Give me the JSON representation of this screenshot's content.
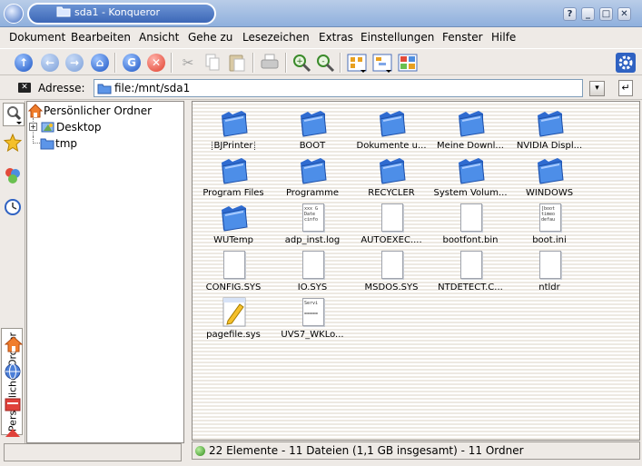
{
  "window": {
    "title": "sda1 - Konqueror",
    "buttons": [
      "?",
      "_",
      "□",
      "✕"
    ]
  },
  "menu": [
    "Dokument",
    "Bearbeiten",
    "Ansicht",
    "Gehe zu",
    "Lesezeichen",
    "Extras",
    "Einstellungen",
    "Fenster",
    "Hilfe"
  ],
  "toolbar": {
    "icons": [
      "up-arrow-icon",
      "back-arrow-icon",
      "forward-arrow-icon",
      "home-icon",
      "reload-icon",
      "stop-icon",
      "cut-icon",
      "copy-icon",
      "paste-icon",
      "print-icon",
      "zoom-in-icon",
      "zoom-out-icon",
      "icon-view-icon",
      "tree-view-icon",
      "multi-view-icon",
      "konqueror-gear-icon"
    ]
  },
  "location": {
    "label": "Adresse:",
    "value": "file:/mnt/sda1"
  },
  "sidebar": {
    "tab_label": "Persönlicher Ordner",
    "tree": [
      {
        "label": "Persönlicher Ordner",
        "icon": "home-icon"
      },
      {
        "label": "Desktop",
        "icon": "desktop-icon"
      },
      {
        "label": "tmp",
        "icon": "folder-icon"
      }
    ]
  },
  "files": [
    {
      "name": "BJPrinter",
      "type": "folder",
      "selected": true
    },
    {
      "name": "BOOT",
      "type": "folder"
    },
    {
      "name": "Dokumente u...",
      "type": "folder"
    },
    {
      "name": "Meine Downl...",
      "type": "folder"
    },
    {
      "name": "NVIDIA Displ...",
      "type": "folder"
    },
    {
      "name": "Program Files",
      "type": "folder"
    },
    {
      "name": "Programme",
      "type": "folder"
    },
    {
      "name": "RECYCLER",
      "type": "folder"
    },
    {
      "name": "System Volum...",
      "type": "folder"
    },
    {
      "name": "WINDOWS",
      "type": "folder"
    },
    {
      "name": "WUTemp",
      "type": "folder"
    },
    {
      "name": "adp_inst.log",
      "type": "text",
      "preview": "xxx G\nDate\ncinfo"
    },
    {
      "name": "AUTOEXEC....",
      "type": "file"
    },
    {
      "name": "bootfont.bin",
      "type": "file"
    },
    {
      "name": "boot.ini",
      "type": "text",
      "preview": "[boot\ntimeo\ndefau"
    },
    {
      "name": "CONFIG.SYS",
      "type": "file"
    },
    {
      "name": "IO.SYS",
      "type": "file"
    },
    {
      "name": "MSDOS.SYS",
      "type": "file"
    },
    {
      "name": "NTDETECT.C...",
      "type": "file"
    },
    {
      "name": "ntldr",
      "type": "file"
    },
    {
      "name": "pagefile.sys",
      "type": "pagefile"
    },
    {
      "name": "UVS7_WKLo...",
      "type": "text",
      "preview": "Servi\n\n====="
    }
  ],
  "status": {
    "text": "22 Elemente - 11 Dateien (1,1 GB insgesamt) - 11 Ordner"
  },
  "colors": {
    "title_gradient_top": "#b9cde8",
    "title_gradient_bottom": "#8fb0dd",
    "folder_blue": "#3f7fe0",
    "status_green": "#2f8a19"
  }
}
